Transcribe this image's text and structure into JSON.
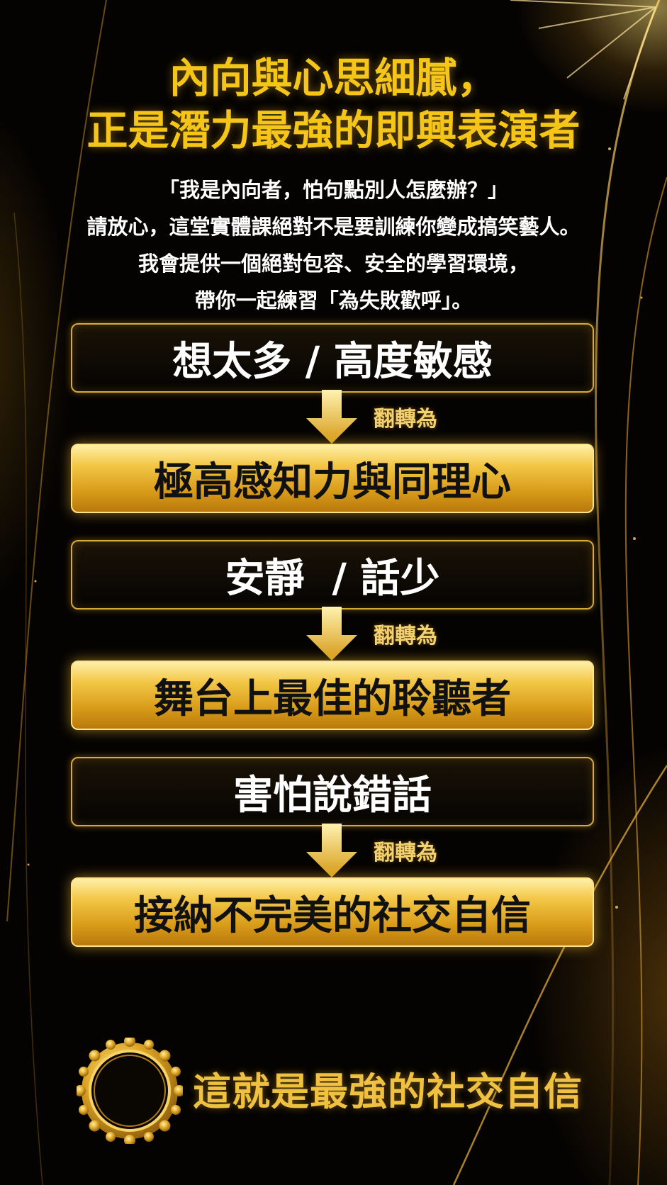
{
  "header": {
    "title_line1": "內向與心思細膩，",
    "title_line2": "正是潛力最強的即興表演者"
  },
  "intro": {
    "line1": "「我是內向者，怕句點別人怎麼辦？」",
    "line2": "請放心，這堂實體課絕對不是要訓練你變成搞笑藝人。",
    "line3": "我會提供一個絕對包容、安全的學習環境，",
    "line4": "帶你一起練習「為失敗歡呼」。"
  },
  "transformations": [
    {
      "from": "想太多 / 高度敏感",
      "flip_label": "翻轉為",
      "to": "極高感知力與同理心"
    },
    {
      "from": "安靜  / 話少",
      "flip_label": "翻轉為",
      "to": "舞台上最佳的聆聽者"
    },
    {
      "from": "害怕說錯話",
      "flip_label": "翻轉為",
      "to": "接納不完美的社交自信"
    }
  ],
  "conclusion": {
    "text": "這就是最強的社交自信"
  },
  "icons": {
    "arrow": "down-arrow-icon",
    "seal": "gold-seal-icon"
  },
  "colors": {
    "gold": "#f5c518",
    "background": "#050302",
    "white": "#ffffff"
  }
}
